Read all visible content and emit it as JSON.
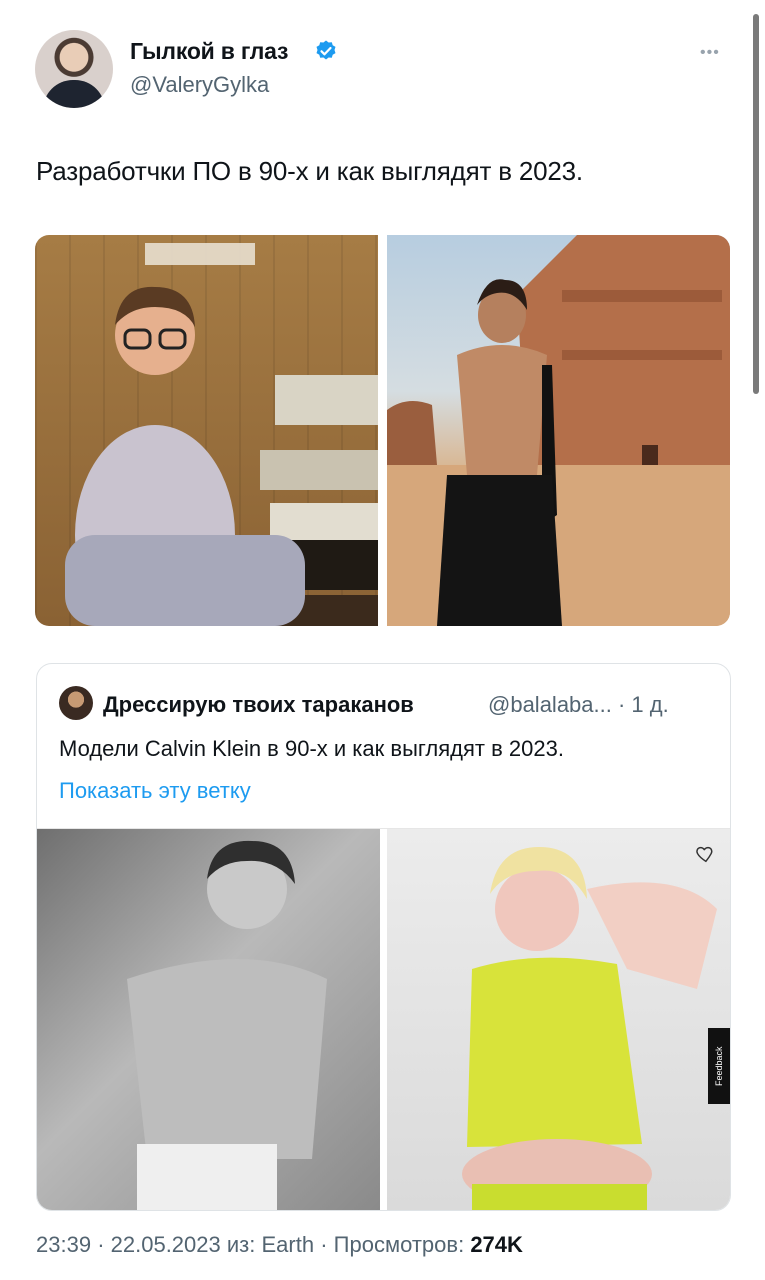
{
  "author": {
    "display_name": "Гылкой в глаз",
    "handle": "@ValeryGylka",
    "verified": true
  },
  "tweet": {
    "text": "Разработчки ПО в 90-х и как выглядят в 2023."
  },
  "more_icon": "more-horizontal-icon",
  "quoted_tweet": {
    "author_name": "Дрессирую твоих тараканов",
    "handle_and_time": "@balalaba... · 1 д.",
    "text": "Модели Calvin Klein в 90-х и как выглядят в 2023.",
    "thread_link": "Показать эту ветку",
    "feedback_tab": "Feedback"
  },
  "meta": {
    "time": "23:39",
    "date": "22.05.2023",
    "source_prefix": "из:",
    "source": "Earth",
    "views_label": "Просмотров:",
    "views_count": "274K"
  },
  "colors": {
    "accent": "#1d9bf0",
    "secondary_text": "#536471",
    "verified": "#1d9bf0"
  }
}
